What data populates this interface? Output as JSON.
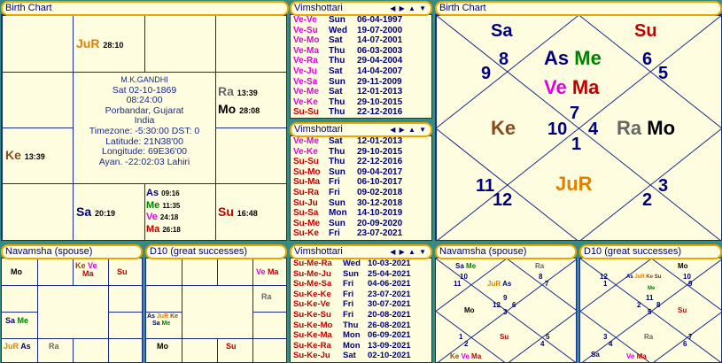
{
  "colors": {
    "blue": "#00007a",
    "red": "#c00000",
    "magenta": "#e000e0",
    "green": "#008000",
    "orange": "#e08000",
    "brown": "#8a4a20",
    "gray": "#666666",
    "black": "#000000"
  },
  "birth": {
    "title": "Birth Chart",
    "info": [
      "M.K.GANDHI",
      "Sat 02-10-1869",
      "08:24:00",
      "Porbandar, Gujarat",
      "India",
      "Timezone: -5:30:00 DST: 0",
      "Latitude: 21N38'00",
      "Longitude: 69E36'00",
      "Ayan. -22:02:03 Lahiri"
    ],
    "jur": {
      "name": "JuR",
      "deg": "28:10"
    },
    "ra": {
      "name": "Ra",
      "deg": "13:39"
    },
    "mo": {
      "name": "Mo",
      "deg": "28:08"
    },
    "ke": {
      "name": "Ke",
      "deg": "13:39"
    },
    "sa": {
      "name": "Sa",
      "deg": "20:19"
    },
    "su": {
      "name": "Su",
      "deg": "16:48"
    },
    "as": {
      "name": "As",
      "deg": "09:16"
    },
    "me": {
      "name": "Me",
      "deg": "11:35"
    },
    "ve": {
      "name": "Ve",
      "deg": "24:18"
    },
    "ma": {
      "name": "Ma",
      "deg": "26:18"
    }
  },
  "v1": {
    "title": "Vimshottari",
    "nav": "◀ ▶ ▲ ▼",
    "rows": [
      [
        "Ve-Ve",
        "Sun",
        "06-04-1997"
      ],
      [
        "Ve-Su",
        "Wed",
        "19-07-2000"
      ],
      [
        "Ve-Mo",
        "Sat",
        "14-07-2001"
      ],
      [
        "Ve-Ma",
        "Thu",
        "06-03-2003"
      ],
      [
        "Ve-Ra",
        "Thu",
        "29-04-2004"
      ],
      [
        "Ve-Ju",
        "Sat",
        "14-04-2007"
      ],
      [
        "Ve-Sa",
        "Sun",
        "29-11-2009"
      ],
      [
        "Ve-Me",
        "Sat",
        "12-01-2013"
      ],
      [
        "Ve-Ke",
        "Thu",
        "29-10-2015"
      ],
      [
        "Su-Su",
        "Thu",
        "22-12-2016"
      ]
    ]
  },
  "v2": {
    "title": "Vimshottari",
    "nav": "◀ ▶ ▲ ▼",
    "rows": [
      [
        "Ve-Me",
        "Sat",
        "12-01-2013"
      ],
      [
        "Ve-Ke",
        "Thu",
        "29-10-2015"
      ],
      [
        "Su-Su",
        "Thu",
        "22-12-2016"
      ],
      [
        "Su-Mo",
        "Sun",
        "09-04-2017"
      ],
      [
        "Su-Ma",
        "Fri",
        "06-10-2017"
      ],
      [
        "Su-Ra",
        "Fri",
        "09-02-2018"
      ],
      [
        "Su-Ju",
        "Sun",
        "30-12-2018"
      ],
      [
        "Su-Sa",
        "Mon",
        "14-10-2019"
      ],
      [
        "Su-Me",
        "Sun",
        "20-09-2020"
      ],
      [
        "Su-Ke",
        "Fri",
        "23-07-2021"
      ]
    ]
  },
  "v3": {
    "title": "Vimshottari",
    "nav": "◀ ▶ ▲ ▼",
    "rows": [
      [
        "Su-Me-Ra",
        "Wed",
        "10-03-2021"
      ],
      [
        "Su-Me-Ju",
        "Sun",
        "25-04-2021"
      ],
      [
        "Su-Me-Sa",
        "Fri",
        "04-06-2021"
      ],
      [
        "Su-Ke-Ke",
        "Fri",
        "23-07-2021"
      ],
      [
        "Su-Ke-Ve",
        "Fri",
        "30-07-2021"
      ],
      [
        "Su-Ke-Su",
        "Fri",
        "20-08-2021"
      ],
      [
        "Su-Ke-Mo",
        "Thu",
        "26-08-2021"
      ],
      [
        "Su-Ke-Ma",
        "Mon",
        "06-09-2021"
      ],
      [
        "Su-Ke-Ra",
        "Mon",
        "13-09-2021"
      ],
      [
        "Su-Ke-Ju",
        "Sat",
        "02-10-2021"
      ]
    ]
  },
  "nn": {
    "title": "Navamsha  (spouse)",
    "mo": "Mo",
    "ke": "Ke",
    "ve": "Ve",
    "ma": "Ma",
    "su": "Su",
    "sa": "Sa",
    "me": "Me",
    "jur": "JuR",
    "as": "As",
    "ra": "Ra"
  },
  "dn": {
    "title": "D10  (great successes)",
    "ve": "Ve",
    "ma": "Ma",
    "ra": "Ra",
    "as": "As",
    "jur": "JuR",
    "ke": "Ke",
    "sa": "Sa",
    "me": "Me",
    "mo": "Mo",
    "su": "Su"
  },
  "east": {
    "title": "Birth Chart",
    "n": [
      "8",
      "9",
      "6",
      "5",
      "7",
      "10",
      "4",
      "1",
      "11",
      "12",
      "3",
      "2"
    ],
    "sa": "Sa",
    "su": "Su",
    "as": "As",
    "me": "Me",
    "ve": "Ve",
    "ma": "Ma",
    "ke": "Ke",
    "ra": "Ra",
    "mo": "Mo",
    "jur": "JuR"
  },
  "nS": {
    "title": "Navamsha  (spouse)",
    "n": [
      "10",
      "11",
      "8",
      "7",
      "9",
      "12",
      "6",
      "3",
      "1",
      "2",
      "5",
      "4"
    ],
    "sa": "Sa",
    "me": "Me",
    "ra": "Ra",
    "jur": "JuR",
    "as": "As",
    "mo": "Mo",
    "su": "Su",
    "ke": "Ke",
    "ve": "Ve",
    "ma": "Ma"
  },
  "dS": {
    "title": "D10  (great successes)",
    "n": [
      "12",
      "1",
      "10",
      "9",
      "11",
      "2",
      "8",
      "5",
      "3",
      "4",
      "7",
      "6"
    ],
    "mo": "Mo",
    "as": "As",
    "jur": "JuR",
    "ke": "Ke",
    "su": "Su",
    "me": "Me",
    "ra": "Ra",
    "sa": "Sa",
    "ve": "Ve",
    "ma": "Ma"
  }
}
